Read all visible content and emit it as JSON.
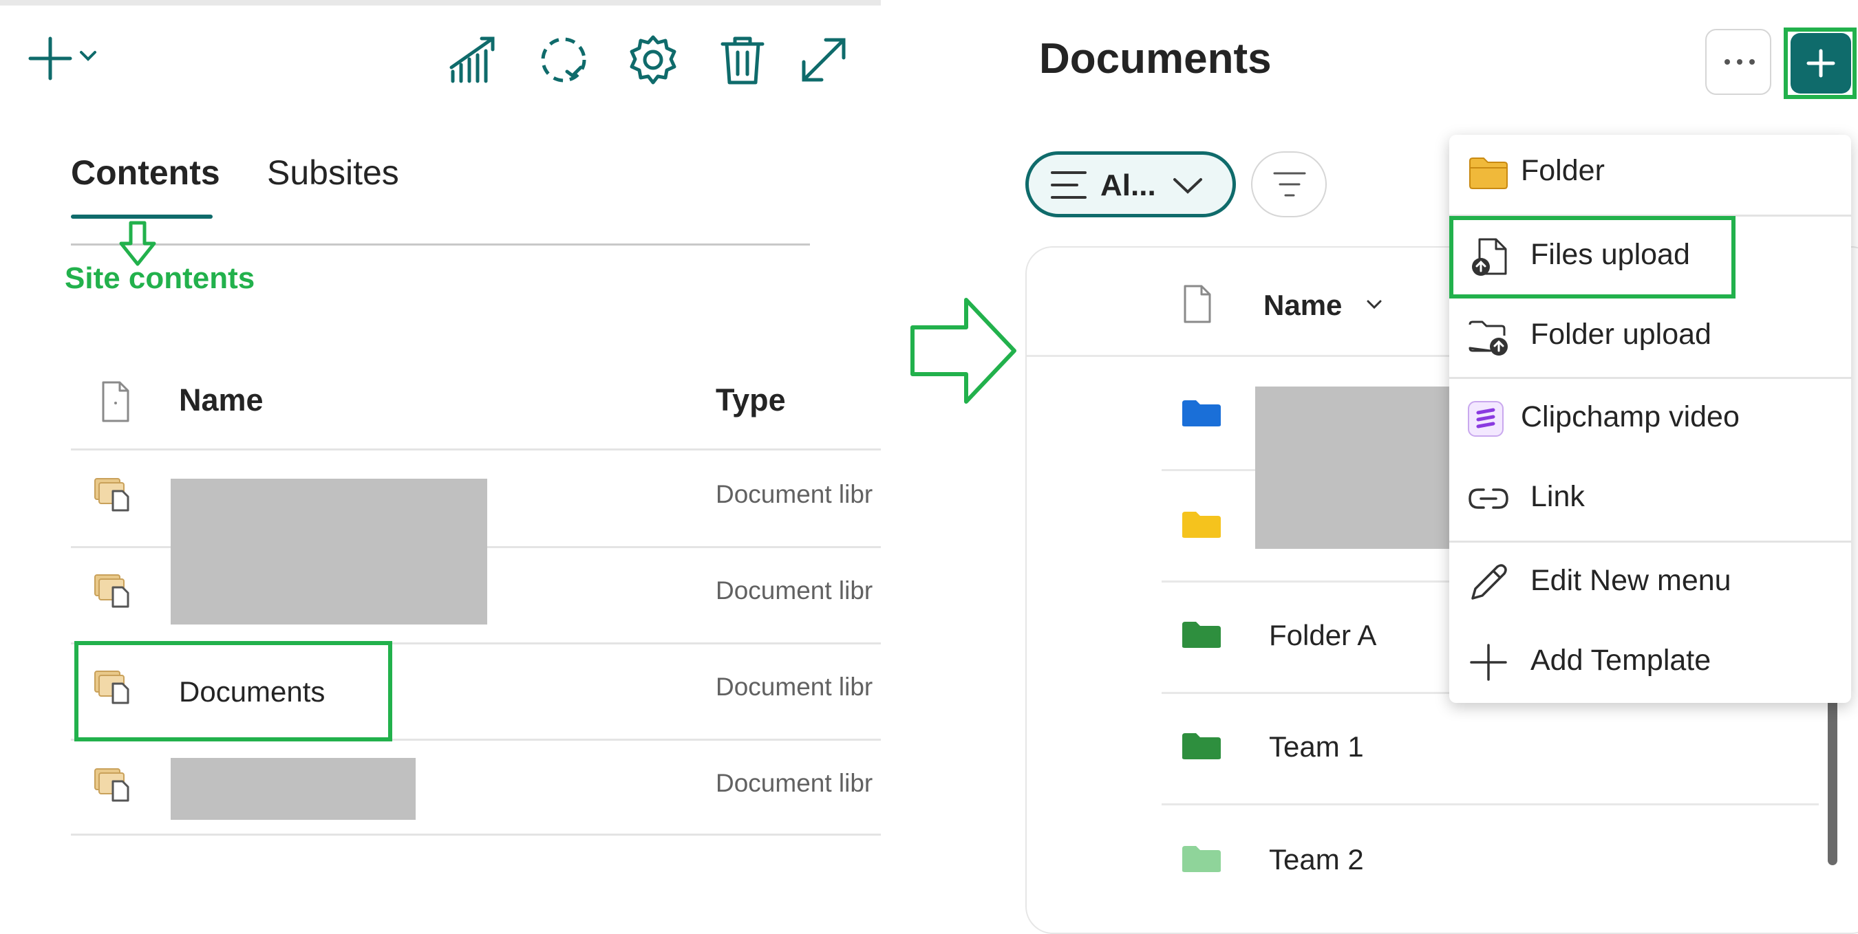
{
  "left_panel": {
    "tabs": [
      {
        "label": "Contents",
        "active": true
      },
      {
        "label": "Subsites",
        "active": false
      }
    ],
    "annotation": "Site contents",
    "columns": {
      "name": "Name",
      "type": "Type"
    },
    "rows": [
      {
        "name": "",
        "type": "Document libr",
        "redacted": true
      },
      {
        "name": "",
        "type": "Document libr",
        "redacted": true
      },
      {
        "name": "Documents",
        "type": "Document libr",
        "highlighted": true
      },
      {
        "name": "",
        "type": "Document libr",
        "redacted": true
      }
    ],
    "toolbar_icons": [
      "add-icon",
      "chevron-down-icon",
      "analytics-icon",
      "recycle-icon",
      "settings-icon",
      "delete-icon",
      "expand-icon"
    ]
  },
  "right_panel": {
    "title": "Documents",
    "view_selector": "Al...",
    "column_name": "Name",
    "rows": [
      {
        "name": "",
        "folder_color": "#1a6fd8",
        "redacted": true
      },
      {
        "name": "",
        "folder_color": "#f5c31d",
        "redacted": true
      },
      {
        "name": "Folder A",
        "folder_color": "#2e8f3e"
      },
      {
        "name": "Team 1",
        "folder_color": "#2e8f3e"
      },
      {
        "name": "Team 2",
        "folder_color": "#8fd49a"
      }
    ],
    "new_menu": [
      {
        "label": "Folder",
        "icon": "folder-icon"
      },
      {
        "label": "Files upload",
        "icon": "file-upload-icon",
        "highlighted": true
      },
      {
        "label": "Folder upload",
        "icon": "folder-upload-icon"
      },
      {
        "label": "Clipchamp video",
        "icon": "clipchamp-icon"
      },
      {
        "label": "Link",
        "icon": "link-icon"
      },
      {
        "label": "Edit New menu",
        "icon": "pencil-icon"
      },
      {
        "label": "Add Template",
        "icon": "plus-icon"
      }
    ]
  },
  "colors": {
    "accent": "#0f6b6b",
    "annotation_green": "#22b14c",
    "redaction": "#c0c0c0"
  }
}
